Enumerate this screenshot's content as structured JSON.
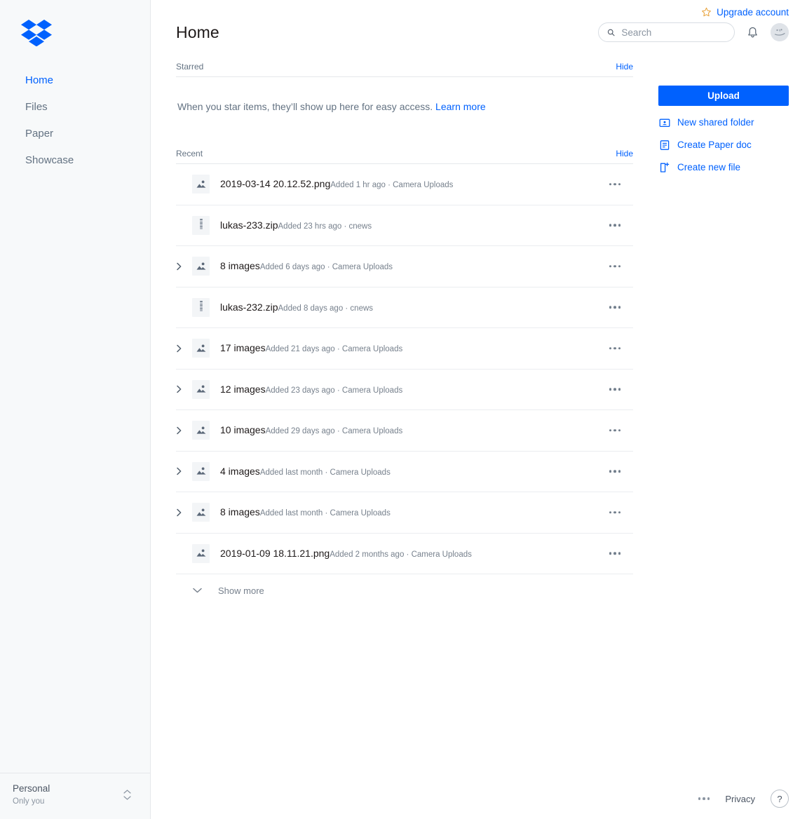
{
  "sidebar": {
    "logo_icon": "dropbox-logo",
    "brand_color": "#0061fe",
    "items": [
      {
        "label": "Home",
        "active": true
      },
      {
        "label": "Files",
        "active": false
      },
      {
        "label": "Paper",
        "active": false
      },
      {
        "label": "Showcase",
        "active": false
      }
    ],
    "account": {
      "name": "Personal",
      "subtitle": "Only you",
      "stepper_icon": "chevron-up-down-icon"
    }
  },
  "header": {
    "title": "Home",
    "upgrade": {
      "label": "Upgrade account",
      "icon": "star-icon",
      "color": "#e8a33d"
    },
    "search": {
      "placeholder": "Search",
      "value": "",
      "icon": "search-icon"
    },
    "notifications_icon": "bell-icon",
    "avatar_icon": "user-avatar"
  },
  "starred": {
    "title": "Starred",
    "hide_label": "Hide",
    "empty_text": "When you star items, they’ll show up here for easy access. ",
    "learn_more_label": "Learn more"
  },
  "recent": {
    "title": "Recent",
    "hide_label": "Hide",
    "show_more_label": "Show more",
    "show_more_icon": "chevron-down-icon",
    "menu_icon": "overflow-menu-icon",
    "rows": [
      {
        "name": "2019-03-14 20.12.52.png",
        "sub": "Added 1 hr ago · Camera Uploads",
        "icon": "image-file-icon",
        "expandable": false
      },
      {
        "name": "lukas-233.zip",
        "sub": "Added 23 hrs ago · cnews",
        "icon": "zip-file-icon",
        "expandable": false
      },
      {
        "name": "8 images",
        "sub": "Added 6 days ago · Camera Uploads",
        "icon": "image-file-icon",
        "expandable": true
      },
      {
        "name": "lukas-232.zip",
        "sub": "Added 8 days ago · cnews",
        "icon": "zip-file-icon",
        "expandable": false
      },
      {
        "name": "17 images",
        "sub": "Added 21 days ago · Camera Uploads",
        "icon": "image-file-icon",
        "expandable": true
      },
      {
        "name": "12 images",
        "sub": "Added 23 days ago · Camera Uploads",
        "icon": "image-file-icon",
        "expandable": true
      },
      {
        "name": "10 images",
        "sub": "Added 29 days ago · Camera Uploads",
        "icon": "image-file-icon",
        "expandable": true
      },
      {
        "name": "4 images",
        "sub": "Added last month · Camera Uploads",
        "icon": "image-file-icon",
        "expandable": true
      },
      {
        "name": "8 images",
        "sub": "Added last month · Camera Uploads",
        "icon": "image-file-icon",
        "expandable": true
      },
      {
        "name": "2019-01-09 18.11.21.png",
        "sub": "Added 2 months ago · Camera Uploads",
        "icon": "image-file-icon",
        "expandable": false
      }
    ]
  },
  "actions": {
    "upload_label": "Upload",
    "links": [
      {
        "label": "New shared folder",
        "icon": "shared-folder-icon"
      },
      {
        "label": "Create Paper doc",
        "icon": "paper-doc-icon"
      },
      {
        "label": "Create new file",
        "icon": "new-file-icon"
      }
    ]
  },
  "footer": {
    "more_icon": "overflow-menu-icon",
    "privacy_label": "Privacy",
    "help_label": "?"
  }
}
